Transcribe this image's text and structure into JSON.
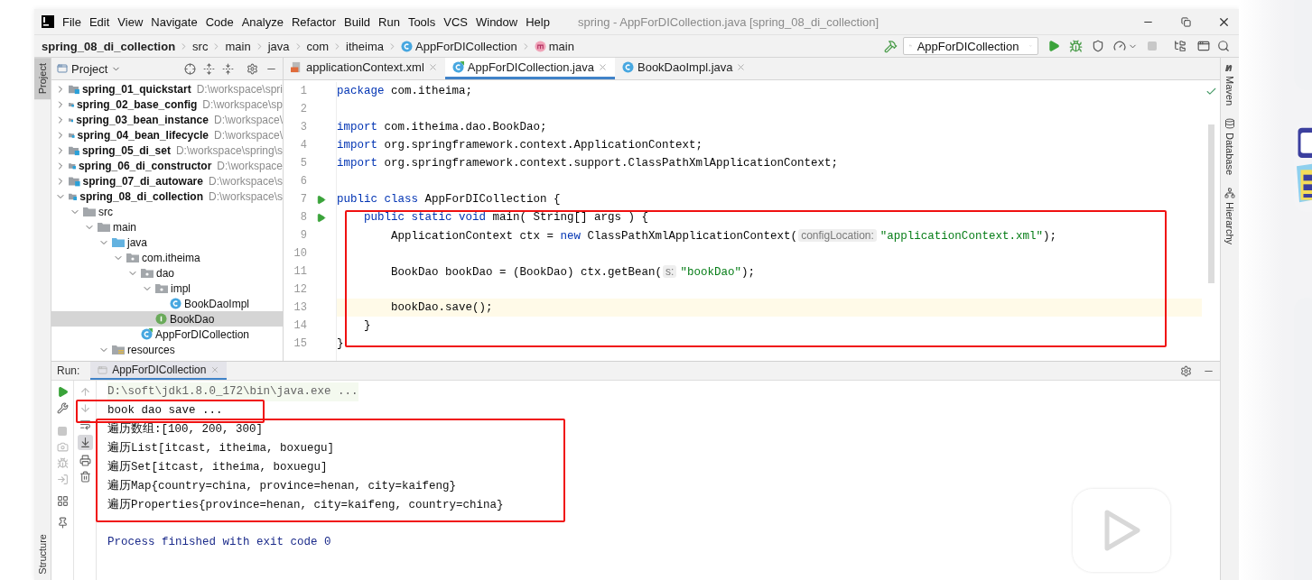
{
  "window": {
    "title": "spring - AppForDICollection.java [spring_08_di_collection]",
    "menu": [
      "File",
      "Edit",
      "View",
      "Navigate",
      "Code",
      "Analyze",
      "Refactor",
      "Build",
      "Run",
      "Tools",
      "VCS",
      "Window",
      "Help"
    ]
  },
  "breadcrumbs": [
    {
      "label": "spring_08_di_collection",
      "kind": "project"
    },
    {
      "label": "src",
      "kind": "plain"
    },
    {
      "label": "main",
      "kind": "plain"
    },
    {
      "label": "java",
      "kind": "plain"
    },
    {
      "label": "com",
      "kind": "plain"
    },
    {
      "label": "itheima",
      "kind": "plain"
    },
    {
      "label": "AppForDICollection",
      "kind": "class"
    },
    {
      "label": "main",
      "kind": "method"
    }
  ],
  "run_config": {
    "label": "AppForDICollection"
  },
  "left_tool_strip": [
    {
      "label": "Project",
      "selected": true
    }
  ],
  "bottom_left_tool_strip": [
    {
      "label": "Structure",
      "selected": false
    }
  ],
  "right_tool_strip": [
    {
      "label": "Maven",
      "kind": "maven"
    },
    {
      "label": "Database",
      "kind": "database"
    },
    {
      "label": "Hierarchy",
      "kind": "hierarchy"
    }
  ],
  "project_panel": {
    "title": "Project",
    "tree": [
      {
        "label": "spring_01_quickstart",
        "path": "D:\\workspace\\spri",
        "kind": "module",
        "expanded": false,
        "selected": false
      },
      {
        "label": "spring_02_base_config",
        "path": "D:\\workspace\\sp",
        "kind": "module",
        "expanded": false,
        "selected": false
      },
      {
        "label": "spring_03_bean_instance",
        "path": "D:\\workspace\\",
        "kind": "module",
        "expanded": false,
        "selected": false
      },
      {
        "label": "spring_04_bean_lifecycle",
        "path": "D:\\workspace\\",
        "kind": "module",
        "expanded": false,
        "selected": false
      },
      {
        "label": "spring_05_di_set",
        "path": "D:\\workspace\\spring\\s",
        "kind": "module",
        "expanded": false,
        "selected": false
      },
      {
        "label": "spring_06_di_constructor",
        "path": "D:\\workspace",
        "kind": "module",
        "expanded": false,
        "selected": false
      },
      {
        "label": "spring_07_di_autoware",
        "path": "D:\\workspace\\s",
        "kind": "module",
        "expanded": false,
        "selected": false
      },
      {
        "label": "spring_08_di_collection",
        "path": "D:\\workspace\\s",
        "kind": "module",
        "expanded": true,
        "selected": false,
        "children": [
          {
            "label": "src",
            "kind": "folder",
            "expanded": true,
            "selected": false,
            "children": [
              {
                "label": "main",
                "kind": "folder",
                "expanded": true,
                "selected": false,
                "children": [
                  {
                    "label": "java",
                    "kind": "source-folder",
                    "expanded": true,
                    "selected": false,
                    "children": [
                      {
                        "label": "com.itheima",
                        "kind": "package",
                        "expanded": true,
                        "selected": false,
                        "children": [
                          {
                            "label": "dao",
                            "kind": "package",
                            "expanded": true,
                            "selected": false,
                            "children": [
                              {
                                "label": "impl",
                                "kind": "package",
                                "expanded": true,
                                "selected": false,
                                "children": [
                                  {
                                    "label": "BookDaoImpl",
                                    "kind": "class",
                                    "selected": false
                                  }
                                ]
                              },
                              {
                                "label": "BookDao",
                                "kind": "interface",
                                "selected": true
                              }
                            ]
                          },
                          {
                            "label": "AppForDICollection",
                            "kind": "main-class",
                            "selected": false
                          }
                        ]
                      }
                    ]
                  },
                  {
                    "label": "resources",
                    "kind": "resources-folder",
                    "expanded": true,
                    "selected": false
                  }
                ]
              }
            ]
          }
        ]
      }
    ]
  },
  "editor": {
    "tabs": [
      {
        "label": "applicationContext.xml",
        "kind": "xml",
        "selected": false
      },
      {
        "label": "AppForDICollection.java",
        "kind": "main-class",
        "selected": true
      },
      {
        "label": "BookDaoImpl.java",
        "kind": "class",
        "selected": false
      }
    ],
    "lines": [
      {
        "number": "1",
        "current": false,
        "run_marker": false,
        "segments": [
          {
            "kind": "keyword",
            "text": "package"
          },
          {
            "kind": "plain",
            "text": " com.itheima;"
          }
        ]
      },
      {
        "number": "2",
        "current": false,
        "run_marker": false
      },
      {
        "number": "3",
        "current": false,
        "run_marker": false,
        "segments": [
          {
            "kind": "keyword",
            "text": "import"
          },
          {
            "kind": "plain",
            "text": " com.itheima.dao.BookDao;"
          }
        ]
      },
      {
        "number": "4",
        "current": false,
        "run_marker": false,
        "segments": [
          {
            "kind": "keyword",
            "text": "import"
          },
          {
            "kind": "plain",
            "text": " org.springframework.context.ApplicationContext;"
          }
        ]
      },
      {
        "number": "5",
        "current": false,
        "run_marker": false,
        "segments": [
          {
            "kind": "keyword",
            "text": "import"
          },
          {
            "kind": "plain",
            "text": " org.springframework.context.support.ClassPathXmlApplicationContext;"
          }
        ]
      },
      {
        "number": "6",
        "current": false,
        "run_marker": false
      },
      {
        "number": "7",
        "current": false,
        "run_marker": true,
        "segments": [
          {
            "kind": "keyword",
            "text": "public class"
          },
          {
            "kind": "plain",
            "text": " AppForDICollection {"
          }
        ]
      },
      {
        "number": "8",
        "current": false,
        "run_marker": true,
        "segments": [
          {
            "kind": "keyword",
            "text": "    public static void"
          },
          {
            "kind": "plain",
            "text": " main( String[] args ) {"
          }
        ]
      },
      {
        "number": "9",
        "current": false,
        "run_marker": false,
        "segments": [
          {
            "kind": "plain",
            "text": "        ApplicationContext ctx = "
          },
          {
            "kind": "keyword",
            "text": "new"
          },
          {
            "kind": "plain",
            "text": " ClassPathXmlApplicationContext("
          },
          {
            "kind": "hint",
            "text": "configLocation:"
          },
          {
            "kind": "string",
            "text": "\"applicationContext.xml\""
          },
          {
            "kind": "plain",
            "text": ");"
          }
        ]
      },
      {
        "number": "10",
        "current": false,
        "run_marker": false
      },
      {
        "number": "11",
        "current": false,
        "run_marker": false,
        "segments": [
          {
            "kind": "plain",
            "text": "        BookDao bookDao = (BookDao) ctx.getBean("
          },
          {
            "kind": "hint",
            "text": "s:"
          },
          {
            "kind": "string",
            "text": "\"bookDao\""
          },
          {
            "kind": "plain",
            "text": ");"
          }
        ]
      },
      {
        "number": "12",
        "current": false,
        "run_marker": false
      },
      {
        "number": "13",
        "current": true,
        "run_marker": false,
        "segments": [
          {
            "kind": "plain",
            "text": "        bookDao.save();"
          }
        ]
      },
      {
        "number": "14",
        "current": false,
        "run_marker": false,
        "segments": [
          {
            "kind": "plain",
            "text": "    }"
          }
        ]
      },
      {
        "number": "15",
        "current": false,
        "run_marker": false,
        "segments": [
          {
            "kind": "plain",
            "text": "}"
          }
        ]
      }
    ]
  },
  "run_panel": {
    "label": "Run:",
    "tabs": [
      {
        "label": "AppForDICollection",
        "selected": true
      }
    ],
    "console": [
      {
        "kind": "command",
        "text": "D:\\soft\\jdk1.8.0_172\\bin\\java.exe ..."
      },
      {
        "kind": "output",
        "text": "book dao save ..."
      },
      {
        "kind": "output",
        "text": "遍历数组:[100, 200, 300]"
      },
      {
        "kind": "output",
        "text": "遍历List[itcast, itheima, boxuegu]"
      },
      {
        "kind": "output",
        "text": "遍历Set[itcast, itheima, boxuegu]"
      },
      {
        "kind": "output",
        "text": "遍历Map{country=china, province=henan, city=kaifeng}"
      },
      {
        "kind": "output",
        "text": "遍历Properties{province=henan, city=kaifeng, country=china}"
      },
      {
        "kind": "process",
        "text": "Process finished with exit code 0"
      }
    ]
  },
  "annotation_boxes": [
    {
      "kind": "editor-frame"
    },
    {
      "kind": "console-frame-top"
    },
    {
      "kind": "console-frame-bottom"
    }
  ],
  "player_overlay": {
    "kind": "play-button"
  }
}
